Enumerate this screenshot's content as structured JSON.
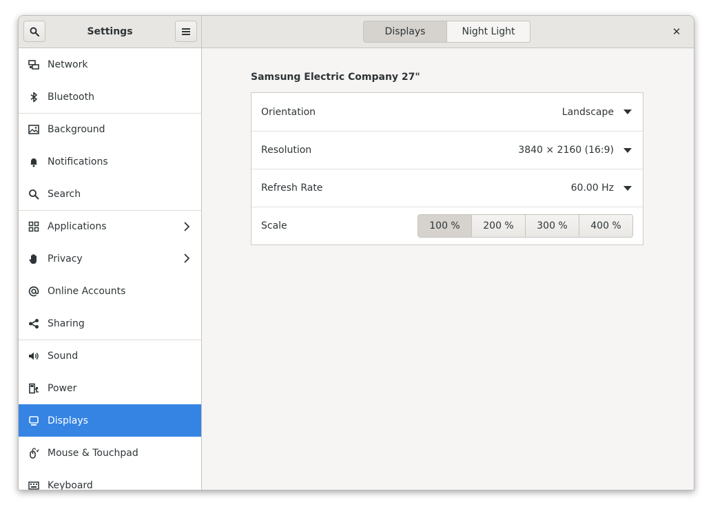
{
  "header": {
    "title": "Settings",
    "search_icon": "search-icon",
    "menu_icon": "hamburger-menu-icon",
    "tabs": [
      {
        "label": "Displays",
        "active": true
      },
      {
        "label": "Night Light",
        "active": false
      }
    ],
    "close_glyph": "✕"
  },
  "sidebar": {
    "items": [
      {
        "label": "Network",
        "icon": "network-icon"
      },
      {
        "label": "Bluetooth",
        "icon": "bluetooth-icon"
      },
      {
        "label": "Background",
        "icon": "background-icon"
      },
      {
        "label": "Notifications",
        "icon": "bell-icon"
      },
      {
        "label": "Search",
        "icon": "search-icon"
      },
      {
        "label": "Applications",
        "icon": "apps-grid-icon",
        "has_children": true
      },
      {
        "label": "Privacy",
        "icon": "hand-icon",
        "has_children": true
      },
      {
        "label": "Online Accounts",
        "icon": "at-sign-icon"
      },
      {
        "label": "Sharing",
        "icon": "share-icon"
      },
      {
        "label": "Sound",
        "icon": "speaker-icon"
      },
      {
        "label": "Power",
        "icon": "power-icon"
      },
      {
        "label": "Displays",
        "icon": "display-icon",
        "selected": true
      },
      {
        "label": "Mouse & Touchpad",
        "icon": "mouse-icon"
      },
      {
        "label": "Keyboard",
        "icon": "keyboard-icon"
      }
    ]
  },
  "display": {
    "monitor_name": "Samsung Electric Company 27\"",
    "orientation": {
      "label": "Orientation",
      "value": "Landscape"
    },
    "resolution": {
      "label": "Resolution",
      "value": "3840 × 2160 (16:9)"
    },
    "refresh_rate": {
      "label": "Refresh Rate",
      "value": "60.00 Hz"
    },
    "scale": {
      "label": "Scale",
      "options": [
        "100 %",
        "200 %",
        "300 %",
        "400 %"
      ],
      "selected": "100 %"
    }
  },
  "colors": {
    "accent": "#3584e4",
    "window_bg": "#f6f5f4",
    "header_bg": "#e8e6e3"
  }
}
